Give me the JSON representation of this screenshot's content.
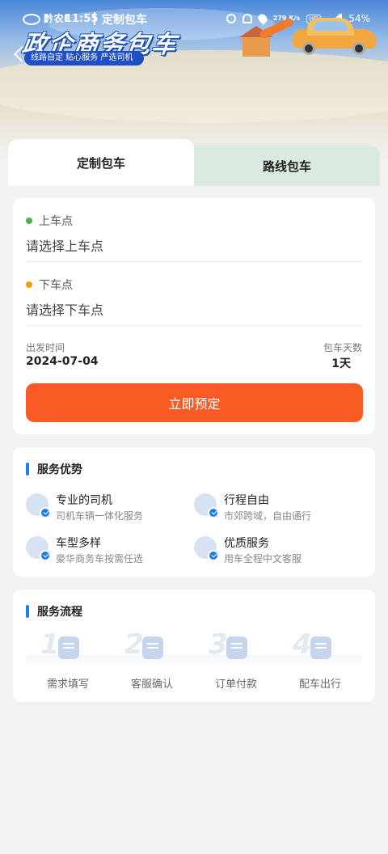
{
  "status_bar": {
    "carrier_brand": "黔农E",
    "time": "11:55",
    "app_name": "定制包车",
    "network": "279 K/s",
    "battery": "54%"
  },
  "hero": {
    "title": "政企商务包车",
    "slogan": "线路自定  贴心服务  严选司机"
  },
  "tabs": [
    {
      "label": "定制包车",
      "active": true
    },
    {
      "label": "路线包车",
      "active": false
    }
  ],
  "form": {
    "pickup": {
      "label": "上车点",
      "placeholder": "请选择上车点",
      "dot_color": "#4caf50"
    },
    "dropoff": {
      "label": "下车点",
      "placeholder": "请选择下车点",
      "dot_color": "#f39c12"
    },
    "departure_label": "出发时间",
    "departure_value": "2024-07-04",
    "days_label": "包车天数",
    "days_value": "1天",
    "submit_label": "立即预定"
  },
  "advantages": {
    "title": "服务优势",
    "items": [
      {
        "name": "专业的司机",
        "desc": "司机车辆一体化服务",
        "icon": "driver-icon"
      },
      {
        "name": "行程自由",
        "desc": "市郊跨域，自由通行",
        "icon": "compass-icon"
      },
      {
        "name": "车型多样",
        "desc": "豪华商务车按需任选",
        "icon": "van-icon"
      },
      {
        "name": "优质服务",
        "desc": "用车全程中文客服",
        "icon": "headset-icon"
      }
    ]
  },
  "process": {
    "title": "服务流程",
    "steps": [
      {
        "num": "1",
        "label": "需求填写",
        "icon": "form-icon"
      },
      {
        "num": "2",
        "label": "客服确认",
        "icon": "car-check-icon"
      },
      {
        "num": "3",
        "label": "订单付款",
        "icon": "payment-icon"
      },
      {
        "num": "4",
        "label": "配车出行",
        "icon": "car-icon"
      }
    ]
  },
  "colors": {
    "accent": "#1e7ee8",
    "primary_button": "#fa5a23",
    "tab_inactive_bg": "#d9ebe0"
  }
}
